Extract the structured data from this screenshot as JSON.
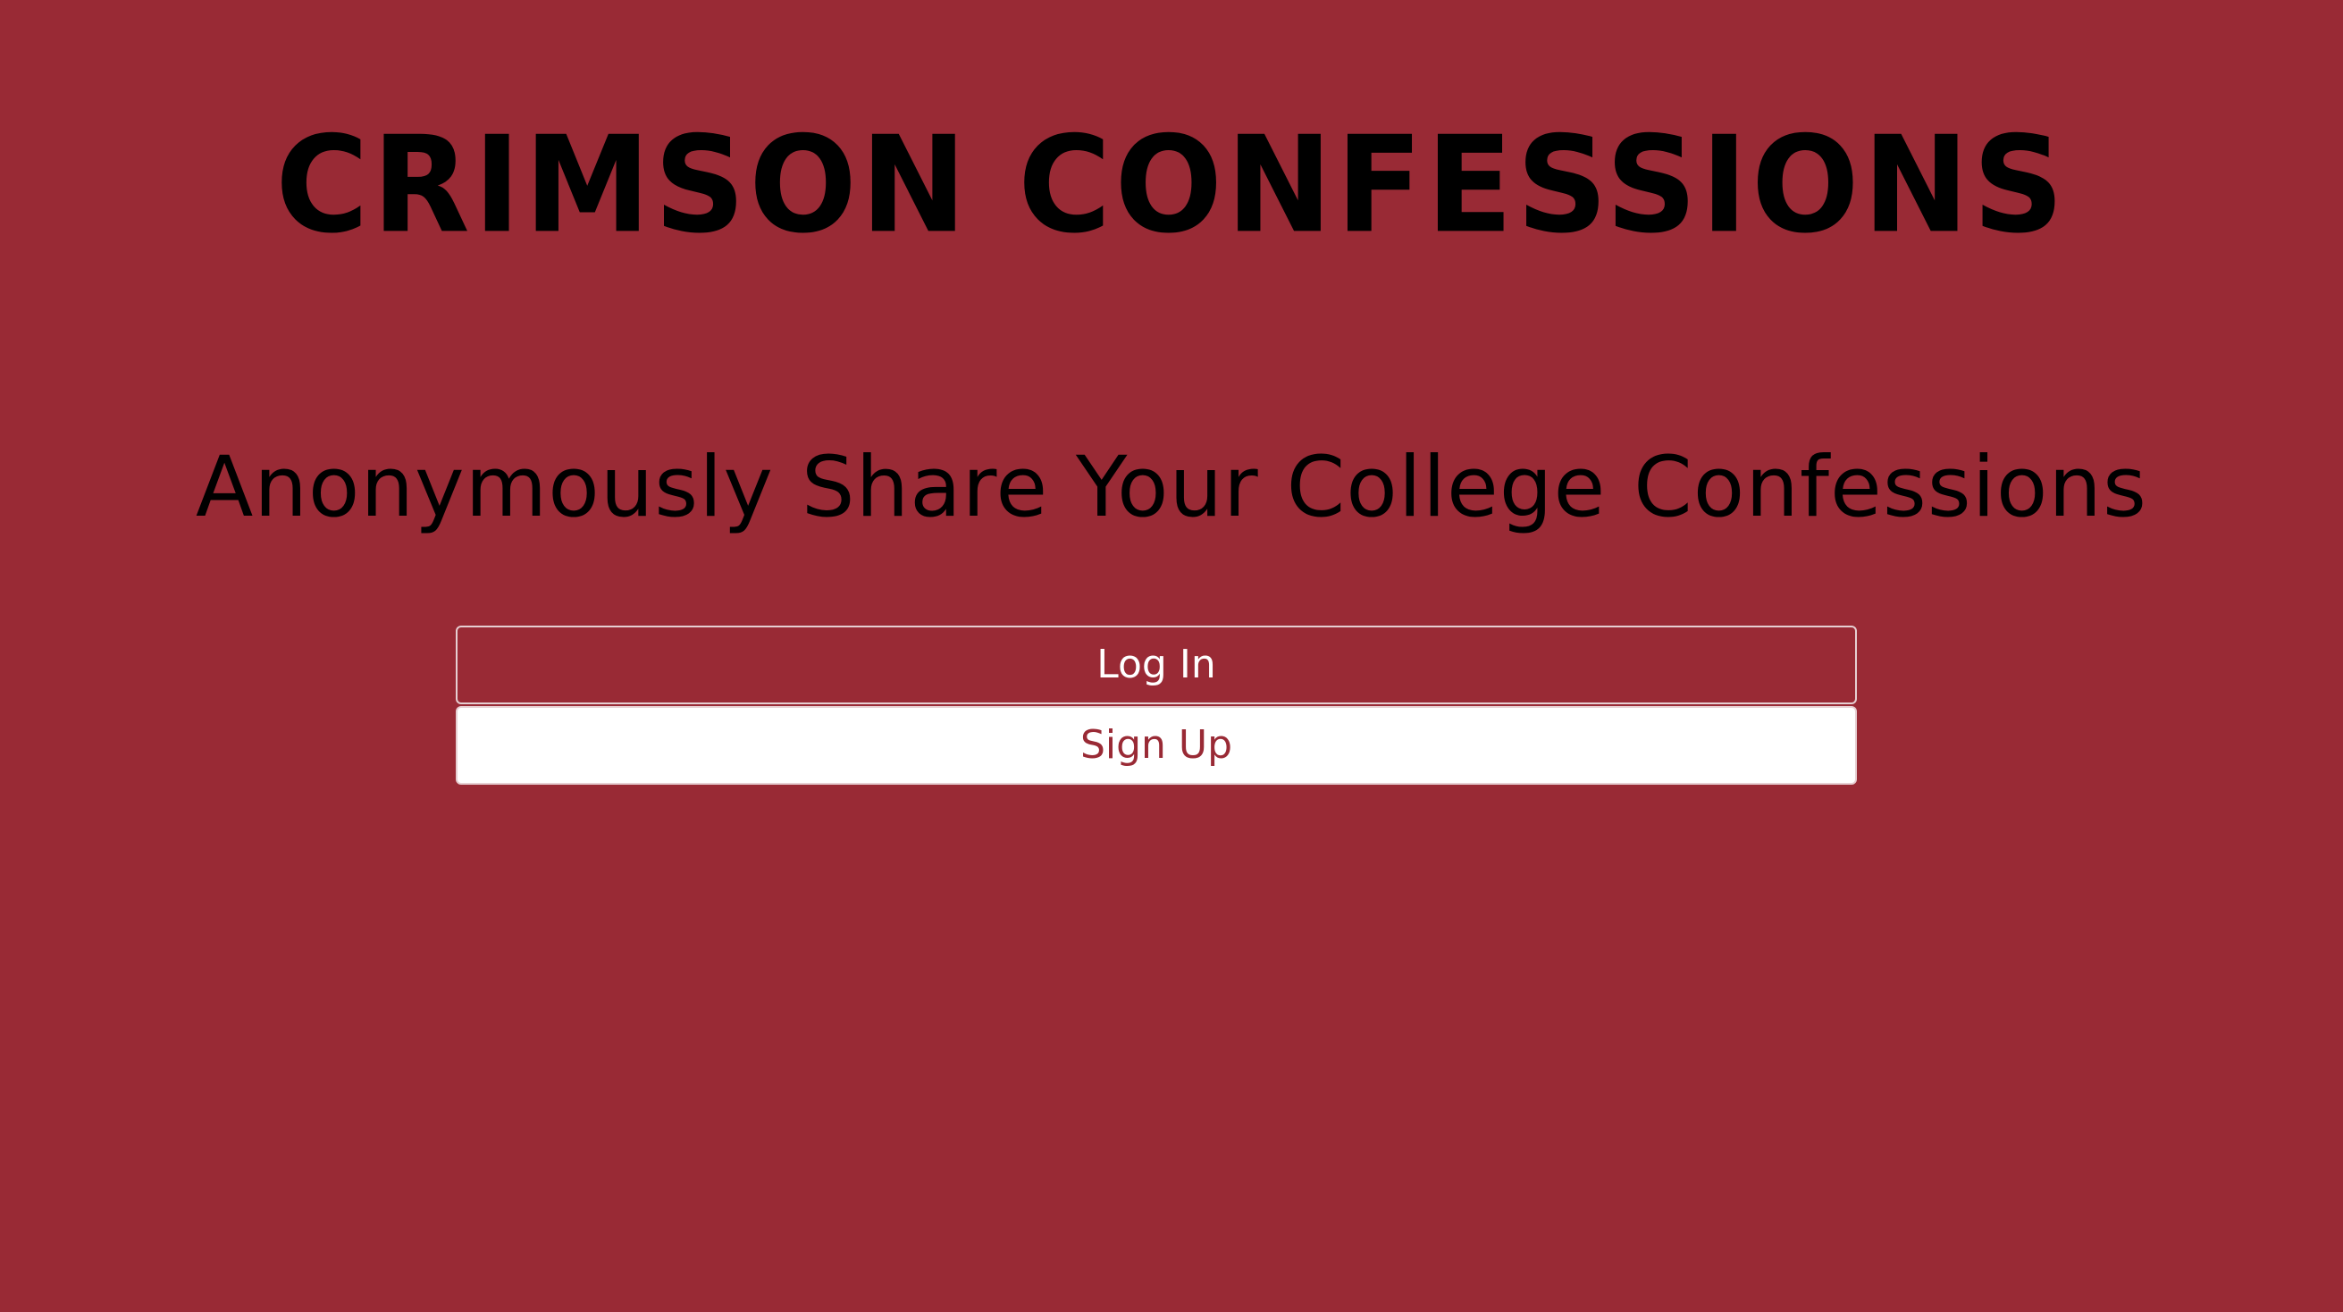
{
  "site": {
    "title": "CRIMSON CONFESSIONS",
    "tagline": "Anonymously Share Your College Confessions"
  },
  "auth": {
    "login_label": "Log In",
    "signup_label": "Sign Up"
  },
  "colors": {
    "background": "#992a35",
    "heading_text": "#000000",
    "login_text": "#ffffff",
    "signup_background": "#ffffff",
    "signup_text": "#992a35"
  }
}
